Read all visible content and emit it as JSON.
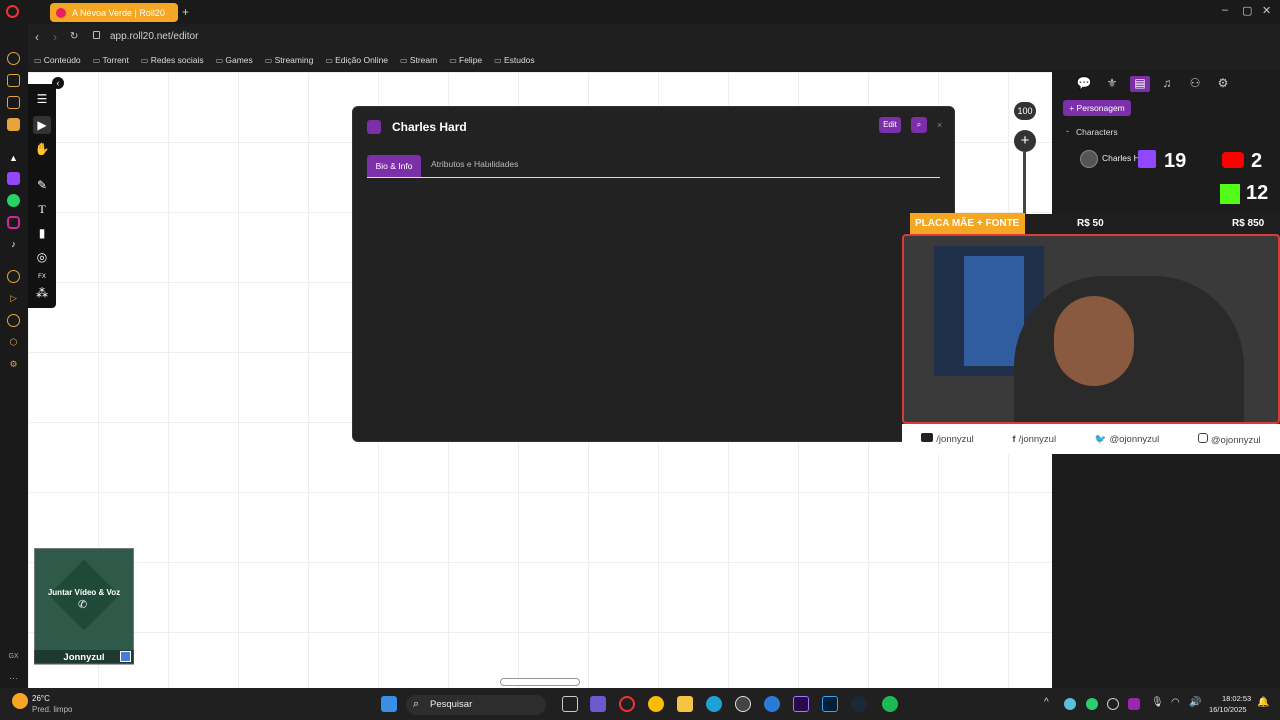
{
  "browser": {
    "tab_title": "A Névoa Verde | Roll20",
    "url": "app.roll20.net/editor",
    "bookmarks": [
      "Conteúdo",
      "Torrent",
      "Redes sociais",
      "Games",
      "Streaming",
      "Edição Online",
      "Stream",
      "Felipe",
      "Estudos"
    ]
  },
  "dialog": {
    "title": "Charles Hard",
    "edit_label": "Edit",
    "close_label": "×",
    "tabs": [
      "Bio & Info",
      "Atributos e Habilidades"
    ]
  },
  "zoom": {
    "level": "100",
    "plus": "+"
  },
  "right_panel": {
    "new_character_label": "+ Personagem",
    "section_label": "Characters",
    "character_name": "Charles Hard"
  },
  "overlay": {
    "stat_twitch": "19",
    "stat_youtube": "2",
    "stat_kick": "12",
    "goal_label": "PLACA MÃE + FONTE",
    "goal_current": "R$ 50",
    "goal_target": "R$ 850",
    "socials": [
      "/jonnyzul",
      "/jonnyzul",
      "@ojonnyzul",
      "@ojonnyzul"
    ]
  },
  "player": {
    "join_label": "Juntar Vídeo & Voz",
    "name": "Jonnyzul"
  },
  "taskbar": {
    "temperature": "26°C",
    "weather": "Pred. limpo",
    "search_placeholder": "Pesquisar",
    "time": "18:02:53",
    "date": "16/10/2025"
  },
  "colors": {
    "accent_purple": "#7b2fa8",
    "overlay_orange": "#f5a623"
  }
}
